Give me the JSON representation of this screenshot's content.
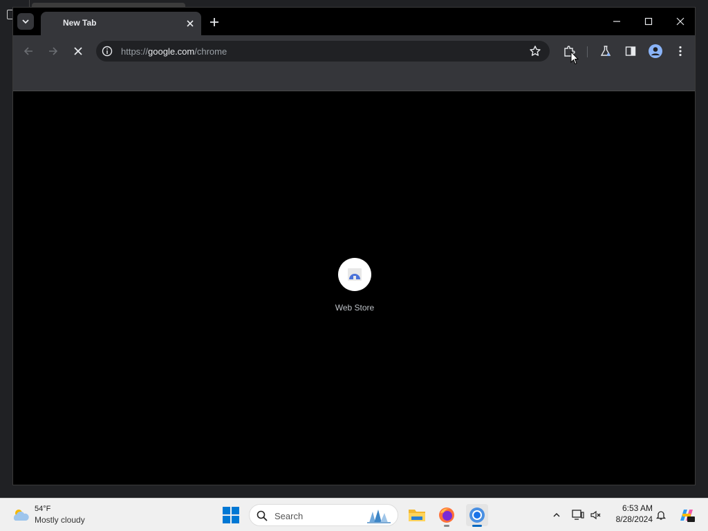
{
  "browser": {
    "tab": {
      "title": "New Tab"
    },
    "omnibox": {
      "url_scheme": "https://",
      "url_host": "google.com",
      "url_path": "/chrome"
    }
  },
  "content": {
    "shortcuts": [
      {
        "label": "Web Store",
        "icon": "web-store-icon"
      }
    ]
  },
  "taskbar": {
    "weather": {
      "temp": "54°F",
      "desc": "Mostly cloudy"
    },
    "search": {
      "placeholder": "Search"
    },
    "clock": {
      "time": "6:53 AM",
      "date": "8/28/2024"
    },
    "pinned_apps": [
      "file-explorer-icon",
      "firefox-icon",
      "chrome-icon"
    ],
    "active_app": "chrome-icon"
  },
  "colors": {
    "toolbar": "#35363a",
    "content_bg": "#000000",
    "taskbar": "#f0f0f0",
    "windows_accent": "#0067c0"
  }
}
